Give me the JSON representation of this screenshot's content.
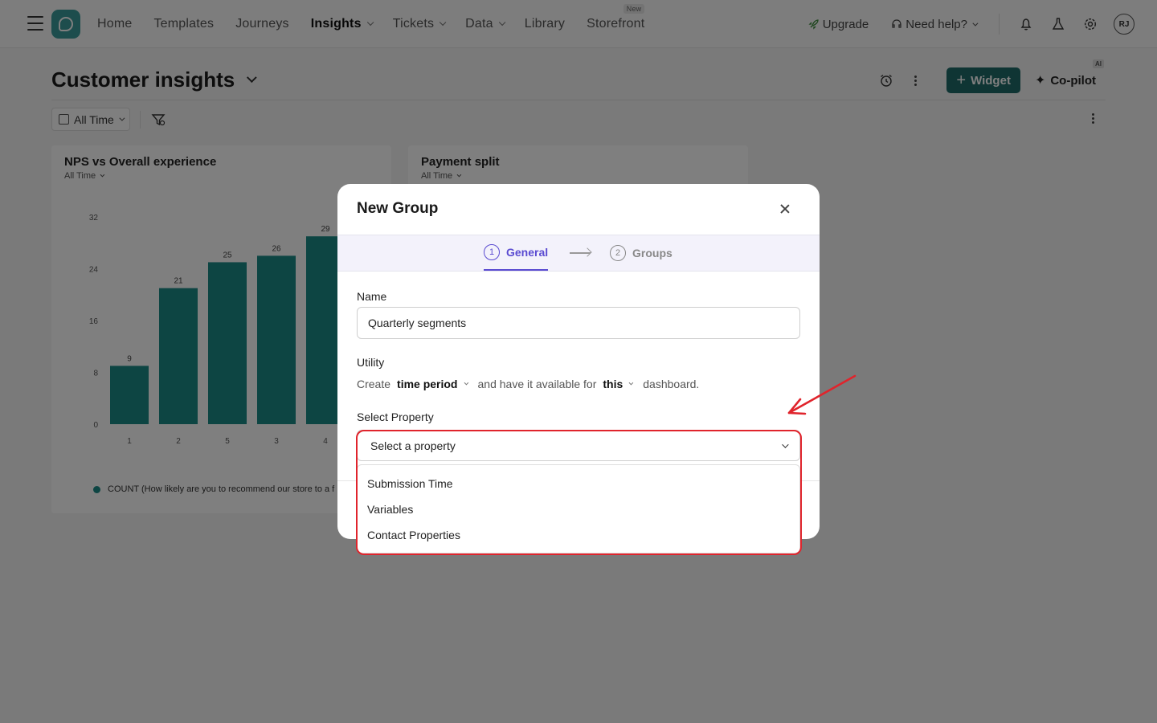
{
  "nav": {
    "items": [
      {
        "label": "Home",
        "active": false,
        "dropdown": false,
        "badge": ""
      },
      {
        "label": "Templates",
        "active": false,
        "dropdown": false,
        "badge": ""
      },
      {
        "label": "Journeys",
        "active": false,
        "dropdown": false,
        "badge": ""
      },
      {
        "label": "Insights",
        "active": true,
        "dropdown": true,
        "badge": ""
      },
      {
        "label": "Tickets",
        "active": false,
        "dropdown": true,
        "badge": ""
      },
      {
        "label": "Data",
        "active": false,
        "dropdown": true,
        "badge": ""
      },
      {
        "label": "Library",
        "active": false,
        "dropdown": false,
        "badge": ""
      },
      {
        "label": "Storefront",
        "active": false,
        "dropdown": false,
        "badge": "New"
      }
    ],
    "upgrade_label": "Upgrade",
    "help_label": "Need help?",
    "avatar_initials": "RJ"
  },
  "header": {
    "title": "Customer insights",
    "widget_label": "Widget",
    "copilot_label": "Co-pilot",
    "ai_badge": "AI"
  },
  "filters": {
    "time_range": "All Time"
  },
  "cards": [
    {
      "title": "NPS vs Overall experience",
      "subtitle": "All Time"
    },
    {
      "title": "Payment split",
      "subtitle": "All Time"
    }
  ],
  "chart_data": {
    "type": "bar",
    "title": "NPS vs Overall experience",
    "categories": [
      "1",
      "2",
      "5",
      "3",
      "4"
    ],
    "values": [
      9,
      21,
      25,
      26,
      29
    ],
    "ylim": [
      0,
      32
    ],
    "yticks": [
      0,
      8,
      16,
      24,
      32
    ],
    "grid": false,
    "legend": "bottom-left",
    "series": [
      {
        "name": "COUNT (How likely are you to recommend our store to a f",
        "values": [
          9,
          21,
          25,
          26,
          29
        ]
      }
    ],
    "color": "#1a8a86"
  },
  "modal": {
    "title": "New Group",
    "steps": [
      {
        "num": "1",
        "label": "General",
        "active": true
      },
      {
        "num": "2",
        "label": "Groups",
        "active": false
      }
    ],
    "name_label": "Name",
    "name_value": "Quarterly segments",
    "utility_label": "Utility",
    "utility": {
      "prefix": "Create",
      "type_value": "time period",
      "middle": "and have it available for",
      "scope_value": "this",
      "suffix": "dashboard."
    },
    "property_label": "Select Property",
    "property_placeholder": "Select a property",
    "property_options": [
      "Submission Time",
      "Variables",
      "Contact Properties"
    ]
  },
  "colors": {
    "brand": "#1e6b69",
    "bar": "#1a8a86",
    "step_active": "#5a4bd1",
    "annotation": "#e0242c"
  }
}
